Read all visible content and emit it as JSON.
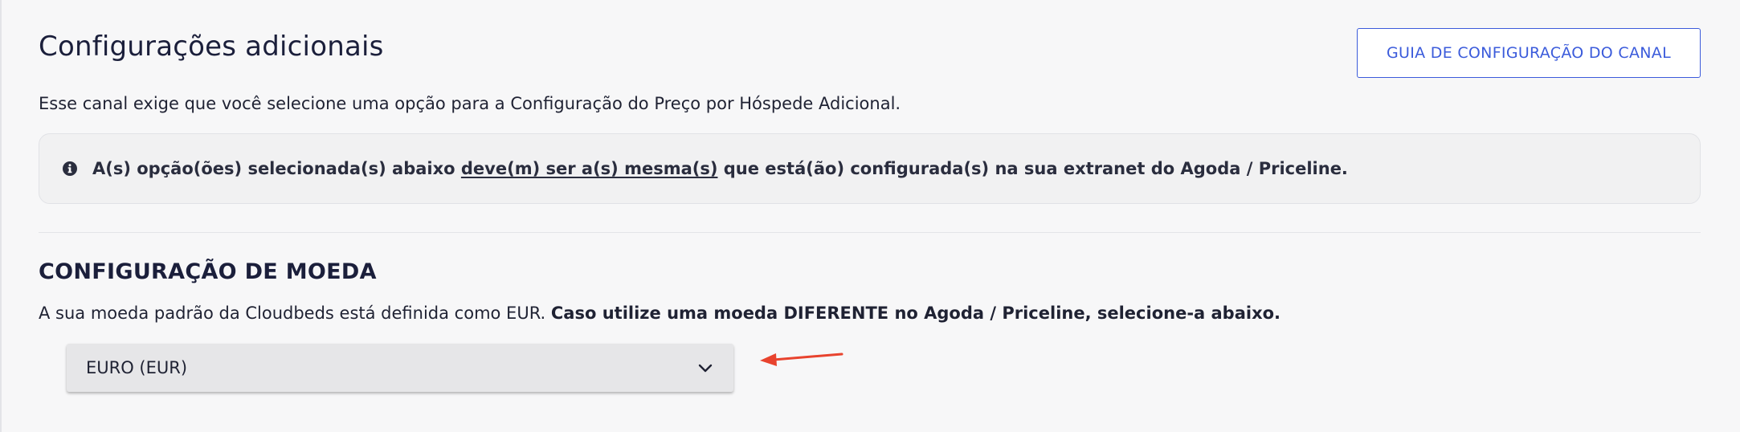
{
  "header": {
    "title": "Configurações adicionais",
    "guide_button_label": "GUIA DE CONFIGURAÇÃO DO CANAL"
  },
  "intro": {
    "text": "Esse canal exige que você selecione uma opção para a Configuração do Preço por Hóspede Adicional."
  },
  "alert": {
    "icon": "info-icon",
    "text_before": "A(s) opção(ões) selecionada(s) abaixo ",
    "text_underlined": "deve(m) ser a(s) mesma(s)",
    "text_after": " que está(ão) configurada(s) na sua extranet do Agoda / Priceline."
  },
  "currency_section": {
    "heading": "CONFIGURAÇÃO DE MOEDA",
    "description": "A sua moeda padrão da Cloudbeds está definida como EUR. ",
    "description_bold": "Caso utilize uma moeda DIFERENTE no Agoda / Priceline, selecione-a abaixo.",
    "select": {
      "selected_value": "EURO (EUR)",
      "icon": "chevron-down-icon"
    }
  },
  "colors": {
    "accent": "#3b5bdb",
    "annotation_arrow": "#e8432e",
    "text": "#1f2233",
    "alert_background": "#f1f1f2"
  }
}
